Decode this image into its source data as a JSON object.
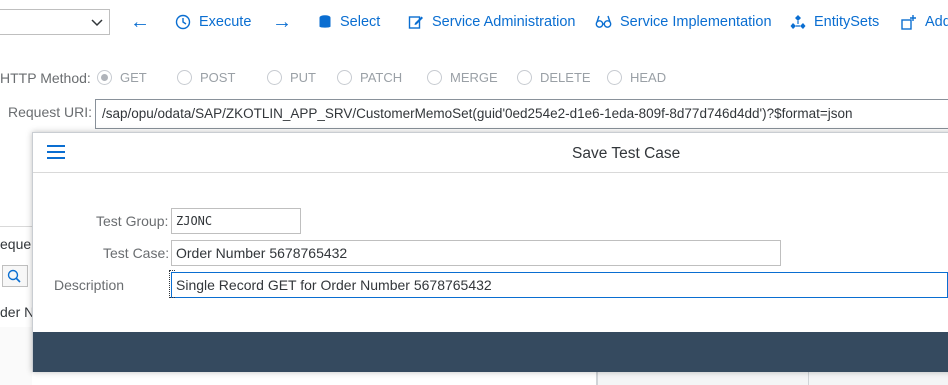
{
  "toolbar": {
    "back_arrow": "←",
    "execute_label": "Execute",
    "forward_arrow": "→",
    "select_label": "Select",
    "service_admin_label": "Service Administration",
    "service_impl_label": "Service Implementation",
    "entitysets_label": "EntitySets",
    "add_label": "Add"
  },
  "request": {
    "http_method_label": "HTTP Method:",
    "methods": [
      "GET",
      "POST",
      "PUT",
      "PATCH",
      "MERGE",
      "DELETE",
      "HEAD"
    ],
    "selected_method": "GET",
    "request_uri_label": "Request URI:",
    "request_uri_value": "/sap/opu/odata/SAP/ZKOTLIN_APP_SRV/CustomerMemoSet(guid'0ed254e2-d1e6-1eda-809f-8d77d746d4dd')?$format=json"
  },
  "background": {
    "partial_text_1": "eque",
    "partial_text_2": "der N"
  },
  "dialog": {
    "title": "Save Test Case",
    "test_group_label": "Test Group:",
    "test_group_value": "ZJONC",
    "test_case_label": "Test Case:",
    "test_case_value": "Order Number 5678765432",
    "description_label": "Description",
    "description_value": "Single Record GET for Order Number 5678765432"
  },
  "colors": {
    "accent": "#0a6ed1",
    "footer": "#354a5f"
  }
}
